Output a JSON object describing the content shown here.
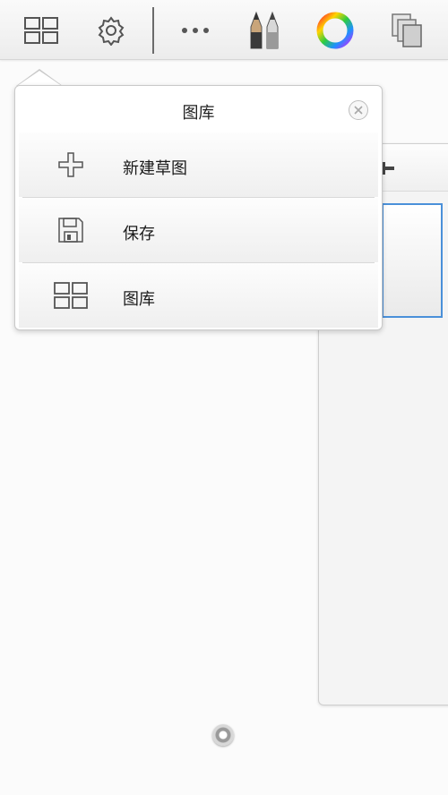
{
  "toolbar": {
    "icons": [
      "gallery-grid-icon",
      "settings-gear-icon",
      "more-dots-icon",
      "brush-tools-icon",
      "color-wheel-icon",
      "layers-icon"
    ]
  },
  "popover": {
    "title": "图库",
    "items": [
      {
        "label": "新建草图",
        "icon": "plus-icon"
      },
      {
        "label": "保存",
        "icon": "save-disk-icon"
      },
      {
        "label": "图库",
        "icon": "gallery-grid-icon"
      }
    ]
  },
  "colors": {
    "thumbnail_selection": "#4a90d9",
    "toolbar_bg": "#f2f2f2"
  }
}
